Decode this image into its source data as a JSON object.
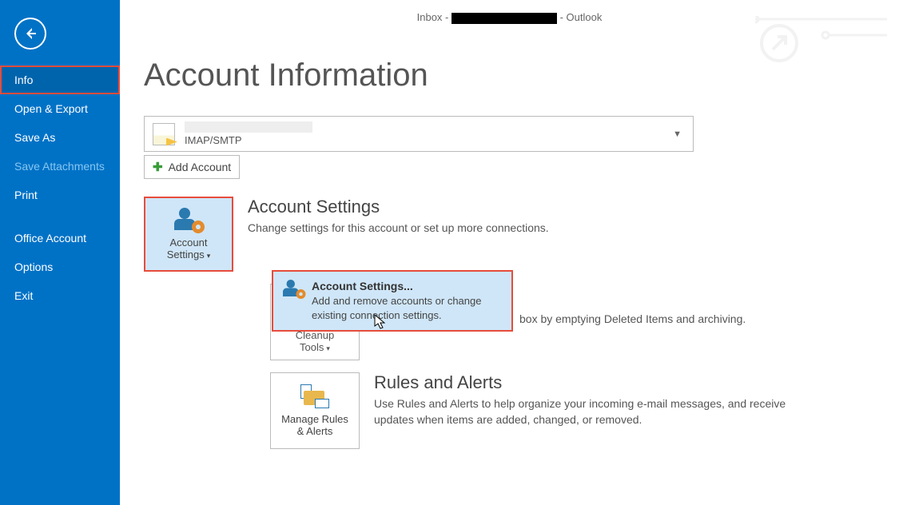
{
  "titlebar": {
    "prefix": "Inbox - ",
    "suffix": " - Outlook"
  },
  "sidebar": {
    "items": [
      {
        "label": "Info",
        "selected": true
      },
      {
        "label": "Open & Export"
      },
      {
        "label": "Save As"
      },
      {
        "label": "Save Attachments",
        "disabled": true
      },
      {
        "label": "Print"
      },
      {
        "spacer": true
      },
      {
        "label": "Office Account"
      },
      {
        "label": "Options"
      },
      {
        "label": "Exit"
      }
    ]
  },
  "page_title": "Account Information",
  "account_dropdown": {
    "type": "IMAP/SMTP"
  },
  "add_account_label": "Add Account",
  "tiles": {
    "account_settings": {
      "line1": "Account",
      "line2": "Settings"
    },
    "cleanup": {
      "line1": "Cleanup",
      "line2": "Tools"
    },
    "rules": {
      "line1": "Manage Rules",
      "line2": "& Alerts"
    }
  },
  "sections": {
    "account": {
      "title": "Account Settings",
      "desc": "Change settings for this account or set up more connections."
    },
    "mailbox": {
      "desc_fragment": "box by emptying Deleted Items and archiving."
    },
    "rules": {
      "title": "Rules and Alerts",
      "desc": "Use Rules and Alerts to help organize your incoming e-mail messages, and receive updates when items are added, changed, or removed."
    }
  },
  "dropdown_menu": {
    "title": "Account Settings...",
    "desc": "Add and remove accounts or change existing connection settings."
  }
}
